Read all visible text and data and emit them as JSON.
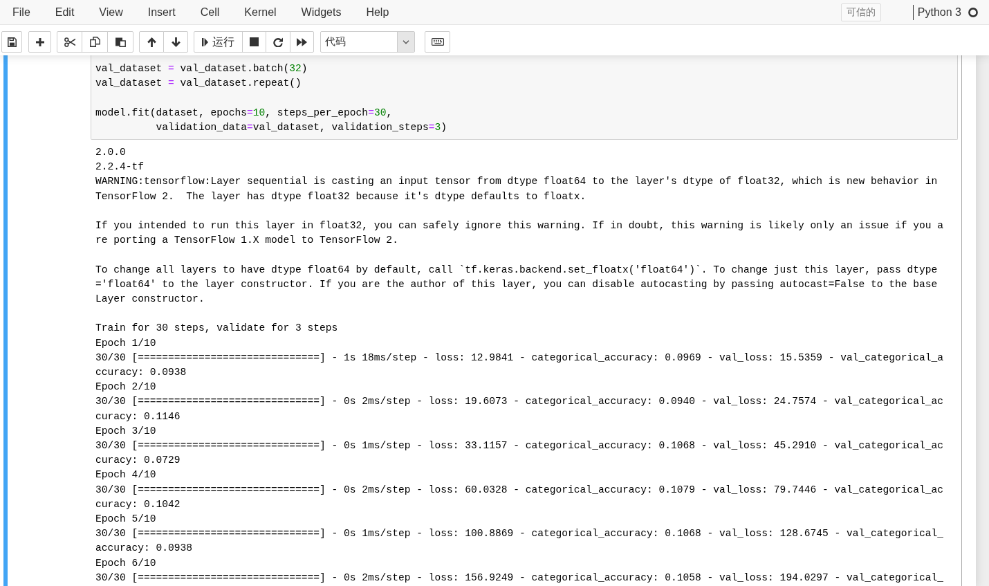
{
  "menu_items": [
    "File",
    "Edit",
    "View",
    "Insert",
    "Cell",
    "Kernel",
    "Widgets",
    "Help"
  ],
  "trusted_badge": "可信的",
  "kernel": {
    "name": "Python 3",
    "busy": false
  },
  "toolbar": {
    "run_label": "运行",
    "cell_type": "代码"
  },
  "cell": {
    "selected": true,
    "code_blocks": [
      {
        "lines": [
          [
            {
              "text": "val_dataset ",
              "kind": "name"
            },
            {
              "text": "=",
              "kind": "op"
            },
            {
              "text": " val_dataset.batch(",
              "kind": "name"
            },
            {
              "text": "32",
              "kind": "number"
            },
            {
              "text": ")",
              "kind": "name"
            }
          ],
          [
            {
              "text": "val_dataset ",
              "kind": "name"
            },
            {
              "text": "=",
              "kind": "op"
            },
            {
              "text": " val_dataset.repeat()",
              "kind": "name"
            }
          ]
        ]
      },
      {
        "lines": [
          [
            {
              "text": "model.fit(dataset, epochs",
              "kind": "name"
            },
            {
              "text": "=",
              "kind": "op"
            },
            {
              "text": "10",
              "kind": "number"
            },
            {
              "text": ", steps_per_epoch",
              "kind": "name"
            },
            {
              "text": "=",
              "kind": "op"
            },
            {
              "text": "30",
              "kind": "number"
            },
            {
              "text": ",",
              "kind": "name"
            }
          ],
          [
            {
              "text": "          validation_data",
              "kind": "name"
            },
            {
              "text": "=",
              "kind": "op"
            },
            {
              "text": "val_dataset, validation_steps",
              "kind": "name"
            },
            {
              "text": "=",
              "kind": "op"
            },
            {
              "text": "3",
              "kind": "number"
            },
            {
              "text": ")",
              "kind": "name"
            }
          ]
        ]
      }
    ],
    "output_blocks": [
      {
        "lines": [
          "2.0.0",
          "2.2.4-tf",
          "WARNING:tensorflow:Layer sequential is casting an input tensor from dtype float64 to the layer's dtype of float32, which is new behavior in TensorFlow 2.  The layer has dtype float32 because it's dtype defaults to floatx."
        ]
      },
      {
        "lines": [
          "If you intended to run this layer in float32, you can safely ignore this warning. If in doubt, this warning is likely only an issue if you are porting a TensorFlow 1.X model to TensorFlow 2."
        ]
      },
      {
        "lines": [
          "To change all layers to have dtype float64 by default, call `tf.keras.backend.set_floatx('float64')`. To change just this layer, pass dtype='float64' to the layer constructor. If you are the author of this layer, you can disable autocasting by passing autocast=False to the base Layer constructor."
        ]
      },
      {
        "lines": [
          "Train for 30 steps, validate for 3 steps",
          "Epoch 1/10",
          "30/30 [==============================] - 1s 18ms/step - loss: 12.9841 - categorical_accuracy: 0.0969 - val_loss: 15.5359 - val_categorical_accuracy: 0.0938",
          "Epoch 2/10",
          "30/30 [==============================] - 0s 2ms/step - loss: 19.6073 - categorical_accuracy: 0.0940 - val_loss: 24.7574 - val_categorical_accuracy: 0.1146",
          "Epoch 3/10",
          "30/30 [==============================] - 0s 1ms/step - loss: 33.1157 - categorical_accuracy: 0.1068 - val_loss: 45.2910 - val_categorical_accuracy: 0.0729",
          "Epoch 4/10",
          "30/30 [==============================] - 0s 2ms/step - loss: 60.0328 - categorical_accuracy: 0.1079 - val_loss: 79.7446 - val_categorical_accuracy: 0.1042",
          "Epoch 5/10",
          "30/30 [==============================] - 0s 1ms/step - loss: 100.8869 - categorical_accuracy: 0.1068 - val_loss: 128.6745 - val_categorical_accuracy: 0.0938",
          "Epoch 6/10",
          "30/30 [==============================] - 0s 2ms/step - loss: 156.9249 - categorical_accuracy: 0.1058 - val_loss: 194.0297 - val_categorical_"
        ]
      }
    ]
  }
}
